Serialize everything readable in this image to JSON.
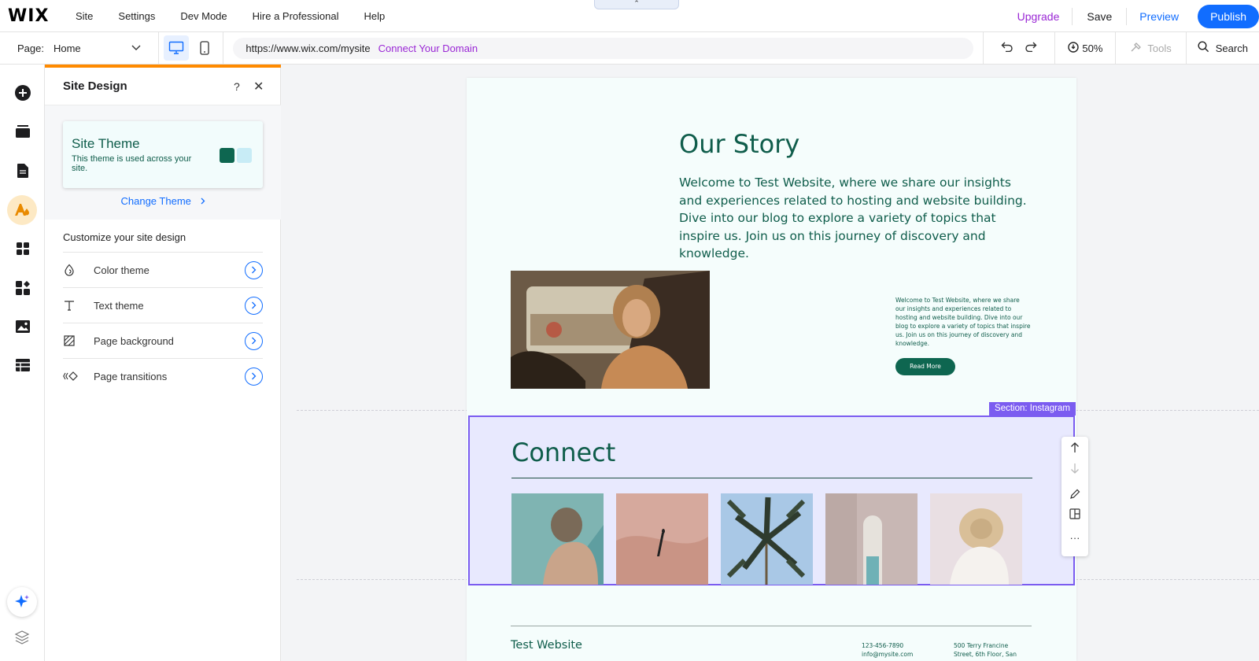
{
  "app": {
    "logo": "WIX"
  },
  "menu": [
    {
      "label": "Site",
      "name": "menu-site"
    },
    {
      "label": "Settings",
      "name": "menu-settings"
    },
    {
      "label": "Dev Mode",
      "name": "menu-dev-mode"
    },
    {
      "label": "Hire a Professional",
      "name": "menu-hire-professional"
    },
    {
      "label": "Help",
      "name": "menu-help"
    }
  ],
  "topbar": {
    "collapse_glyph": "⌃",
    "upgrade": "Upgrade",
    "save": "Save",
    "preview": "Preview",
    "publish": "Publish"
  },
  "colors": {
    "accent": "#116dff",
    "upgrade": "#9a27d5",
    "panel_accent": "#ff8a00",
    "selection": "#7b5cf0",
    "site_green": "#0e6650",
    "site_light": "#c8ecf6"
  },
  "toolbar": {
    "page_label": "Page:",
    "page_value": "Home",
    "url": "https://www.wix.com/mysite",
    "connect_domain": "Connect Your Domain",
    "zoom": "50%",
    "tools": "Tools",
    "search": "Search"
  },
  "rail": [
    {
      "icon": "add-icon"
    },
    {
      "icon": "sections-icon"
    },
    {
      "icon": "pages-icon"
    },
    {
      "icon": "site-design-icon",
      "active": true
    },
    {
      "icon": "apps-icon"
    },
    {
      "icon": "business-icon"
    },
    {
      "icon": "media-icon"
    },
    {
      "icon": "cms-table-icon"
    }
  ],
  "panel": {
    "title": "Site Design",
    "help": "?",
    "close": "✕",
    "theme_card": {
      "name": "Site Theme",
      "description": "This theme is used across your site."
    },
    "change_theme": "Change Theme",
    "customize": "Customize your site design",
    "options": [
      {
        "label": "Color theme",
        "icon": "droplet-icon"
      },
      {
        "label": "Text theme",
        "icon": "text-icon"
      },
      {
        "label": "Page background",
        "icon": "background-icon"
      },
      {
        "label": "Page transitions",
        "icon": "transitions-icon"
      }
    ]
  },
  "site": {
    "story_title": "Our Story",
    "story_text": "Welcome to Test Website, where we share our insights and experiences related to hosting and website building. Dive into our blog to explore a variety of topics that inspire us. Join us on this journey of discovery and knowledge.",
    "small_text": "Welcome to Test Website, where we share our insights and experiences related to hosting and website building. Dive into our blog to explore a variety of topics that inspire us. Join us on this journey of discovery and knowledge.",
    "read_more": "Read More",
    "section_tag": "Section: Instagram",
    "connect_title": "Connect",
    "footer": {
      "brand": "Test Website",
      "phone": "123-456-7890",
      "email": "info@mysite.com",
      "address1": "500 Terry Francine",
      "address2": "Street, 6th Floor, San"
    }
  },
  "section_tools": {
    "more": "···"
  }
}
